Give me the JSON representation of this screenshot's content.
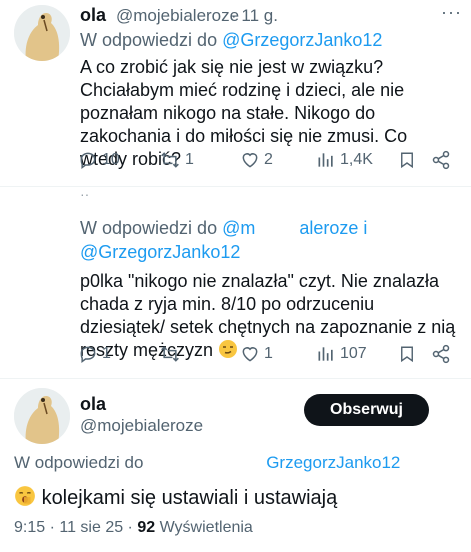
{
  "tweet1": {
    "author_name": "ola",
    "handle": "@mojebialeroze",
    "time": "· 11 g.",
    "reply_prefix": "W odpowiedzi do",
    "reply_to": "@GrzegorzJanko12",
    "text": "A co zrobić jak się nie jest w związku? Chciałabym mieć rodzinę i dzieci, ale nie poznałam nikogo na stałe. Nikogo do zakochania i do miłości się nie zmusi. Co wtedy robić?",
    "replies": "10",
    "reposts": "1",
    "likes": "2",
    "views": "1,4K"
  },
  "tweet2": {
    "reply_prefix": "W odpowiedzi do",
    "reply_to_partial": "@m",
    "reply_to_partial_end": "aleroze i",
    "reply_to_2": "@GrzegorzJanko12",
    "text": "p0lka \"nikogo nie znalazła\" czyt. Nie znalazła chada z ryja min. 8/10 po odrzuceniu dziesiątek/ setek chętnych na zapoznanie z nią reszty mężczyzn",
    "emoji": "smirk",
    "replies": "1",
    "reposts": "",
    "likes": "1",
    "views": "107"
  },
  "tweet3": {
    "author_name": "ola",
    "handle": "@mojebialeroze",
    "follow_label": "Obserwuj",
    "reply_prefix": "W odpowiedzi do",
    "reply_to": "GrzegorzJanko12",
    "text": "kolejkami się ustawiali i ustawiają",
    "emoji": "yawning-face",
    "time": "9:15 · 11 sie 25 ·",
    "views_count": "92",
    "views_label": "Wyświetlenia"
  },
  "colors": {
    "text": "#0f1419",
    "muted": "#536471",
    "link": "#1d9bf0",
    "button": "#0f1419"
  },
  "icons": [
    "reply-icon",
    "repost-icon",
    "like-icon",
    "views-icon",
    "bookmark-icon",
    "share-icon",
    "yawning-face-emoji",
    "smirk-emoji"
  ]
}
